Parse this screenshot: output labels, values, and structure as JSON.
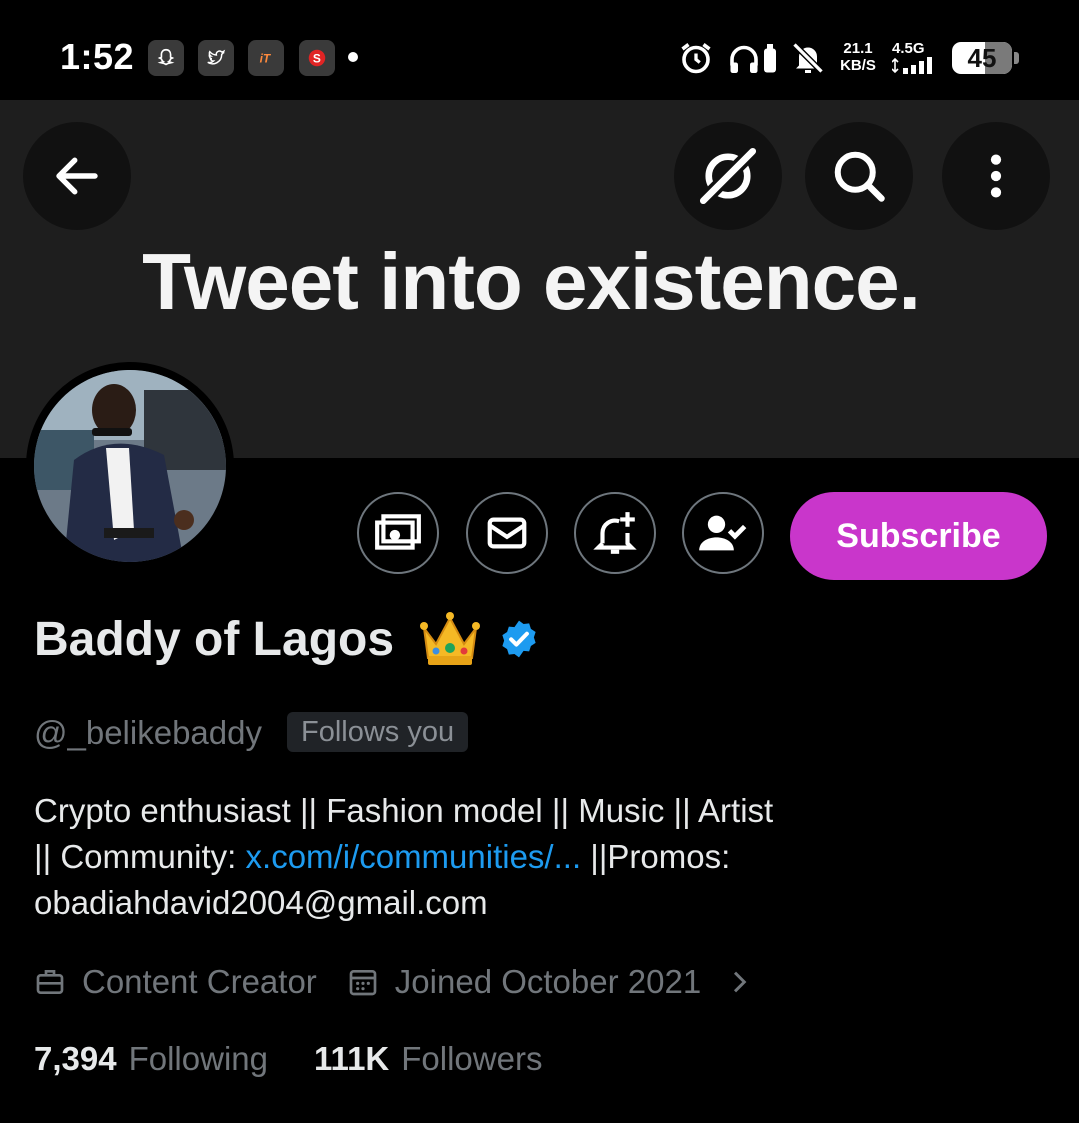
{
  "status_bar": {
    "time": "1:52",
    "notifications": [
      "snapchat-icon",
      "twitter-icon",
      "app-icon",
      "app-icon-red"
    ],
    "net_speed_value": "21.1",
    "net_speed_unit": "KB/S",
    "net_type": "4.5G",
    "battery_level": "45"
  },
  "banner": {
    "text": "Tweet into existence."
  },
  "profile": {
    "display_name": "Baddy of Lagos",
    "handle": "@_belikebaddy",
    "follows_you": "Follows you",
    "bio_line1": "Crypto enthusiast || Fashion model || Music || Artist",
    "bio_line2_prefix": "|| Community: ",
    "bio_link": "x.com/i/communities/...",
    "bio_line2_suffix": " ||Promos:",
    "bio_line3": "obadiahdavid2004@gmail.com",
    "category": "Content Creator",
    "joined": "Joined October 2021",
    "following_count": "7,394",
    "following_label": "Following",
    "followers_count": "111K",
    "followers_label": "Followers"
  },
  "actions": {
    "subscribe_label": "Subscribe"
  },
  "colors": {
    "subscribe": "#c936cb",
    "link": "#1d9bf0",
    "verified": "#1d9bf0",
    "muted": "#71767b"
  }
}
